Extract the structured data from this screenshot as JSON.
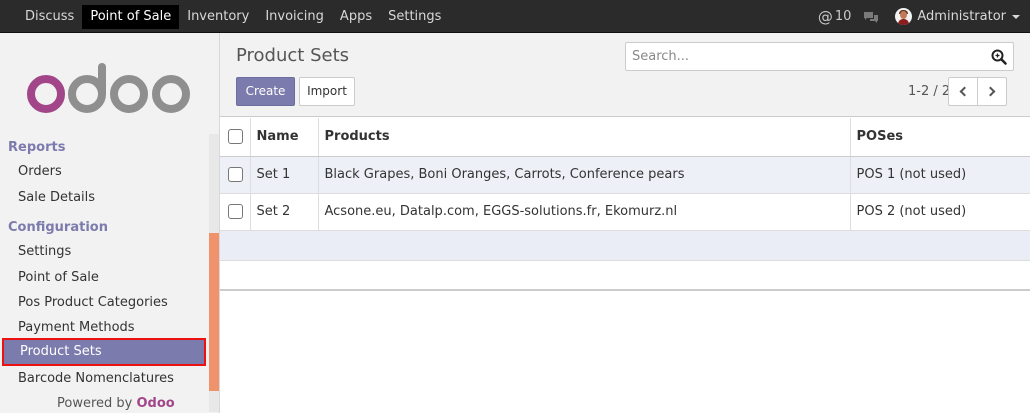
{
  "topbar": {
    "menu": [
      "Discuss",
      "Point of Sale",
      "Inventory",
      "Invoicing",
      "Apps",
      "Settings"
    ],
    "active": "Point of Sale",
    "mentions_count": "10",
    "user_name": "Administrator"
  },
  "sidebar": {
    "reports_title": "Reports",
    "reports_items": [
      "Orders",
      "Sale Details"
    ],
    "config_title": "Configuration",
    "config_items": [
      "Settings",
      "Point of Sale",
      "Pos Product Categories",
      "Payment Methods",
      "Product Sets",
      "Barcode Nomenclatures"
    ],
    "active_item": "Product Sets",
    "powered_by": "Powered by",
    "powered_brand": "Odoo"
  },
  "control_panel": {
    "title": "Product Sets",
    "create_label": "Create",
    "import_label": "Import",
    "search_placeholder": "Search...",
    "pager": "1-2 / 2"
  },
  "table": {
    "columns": [
      "Name",
      "Products",
      "POSes"
    ],
    "rows": [
      {
        "name": "Set 1",
        "products": "Black Grapes, Boni Oranges, Carrots, Conference pears",
        "poses": "POS 1 (not used)"
      },
      {
        "name": "Set 2",
        "products": "Acsone.eu, Datalp.com, EGGS-solutions.fr, Ekomurz.nl",
        "poses": "POS 2 (not used)"
      }
    ]
  },
  "colors": {
    "accent": "#7c7bad",
    "topbar": "#2b2b2b",
    "brand": "#a24689",
    "highlight_border": "#ee1111"
  }
}
